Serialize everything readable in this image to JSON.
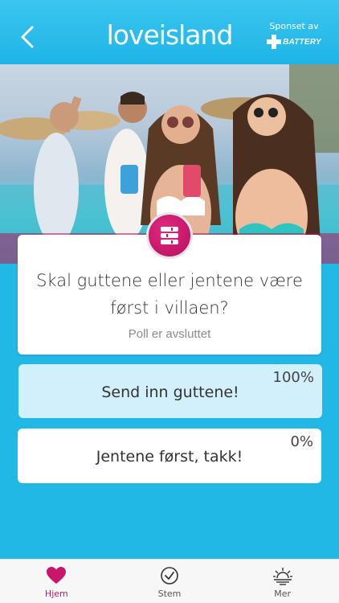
{
  "header": {
    "back_icon": "chevron-left-icon",
    "logo_text_love": "love",
    "logo_text_island": "island",
    "sponsor_label": "Sponset av",
    "sponsor_brand": "BATTERY",
    "bg_color": "#2bbbe9"
  },
  "poll": {
    "badge_icon": "poll-list-icon",
    "question": "Skal guttene eller jentene være først i villaen?",
    "status": "Poll er avsluttet",
    "options": [
      {
        "label": "Send inn guttene!",
        "percent_label": "100%",
        "percent": 100,
        "selected": true
      },
      {
        "label": "Jentene først, takk!",
        "percent_label": "0%",
        "percent": 0,
        "selected": false
      }
    ]
  },
  "tabs": [
    {
      "label": "Hjem",
      "icon": "heart-icon",
      "active": true
    },
    {
      "label": "Stem",
      "icon": "check-circle-icon",
      "active": false
    },
    {
      "label": "Mer",
      "icon": "sunset-icon",
      "active": false
    }
  ],
  "colors": {
    "accent": "#c8176a",
    "background": "#22b8e6",
    "selected_option": "#d2f0fb"
  }
}
